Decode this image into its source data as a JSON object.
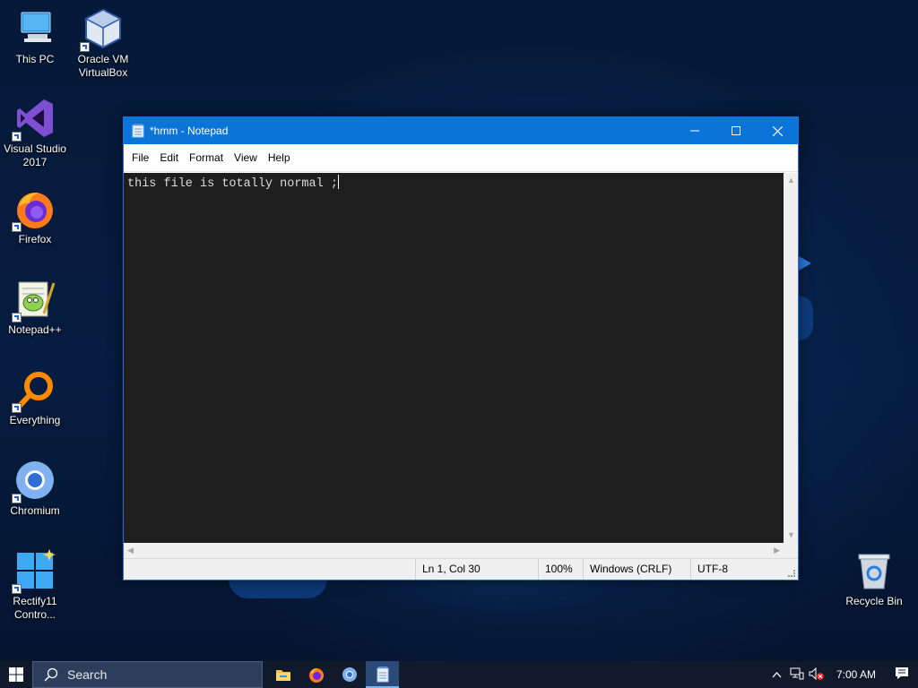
{
  "desktop": {
    "icons": [
      {
        "label": "This PC"
      },
      {
        "label": "Oracle VM VirtualBox"
      },
      {
        "label": "Visual Studio 2017"
      },
      {
        "label": "Firefox"
      },
      {
        "label": "Notepad++"
      },
      {
        "label": "Everything"
      },
      {
        "label": "Chromium"
      },
      {
        "label": "Rectify11 Contro..."
      },
      {
        "label": "Recycle Bin"
      }
    ]
  },
  "notepad": {
    "title": "*hmm - Notepad",
    "menu": [
      "File",
      "Edit",
      "Format",
      "View",
      "Help"
    ],
    "content": "this file is totally normal ;",
    "status": {
      "position": "Ln 1, Col 30",
      "zoom": "100%",
      "line_ending": "Windows (CRLF)",
      "encoding": "UTF-8"
    }
  },
  "taskbar": {
    "search_placeholder": "Search",
    "apps": [
      "file-explorer-icon",
      "firefox-icon",
      "chromium-icon",
      "notepad-icon"
    ],
    "clock": "7:00 AM"
  },
  "colors": {
    "accent": "#0a74d9",
    "editor_bg": "#1e1e1e",
    "taskbar_bg": "#101a2b"
  }
}
